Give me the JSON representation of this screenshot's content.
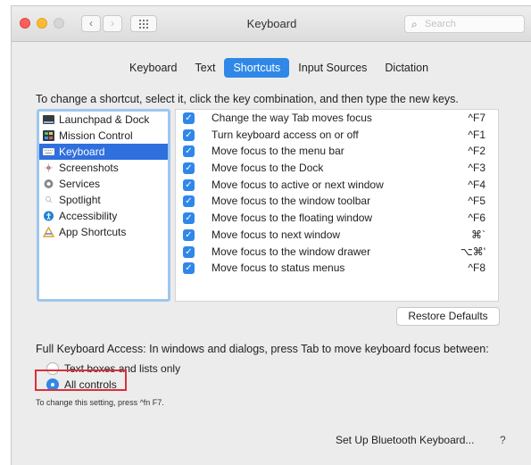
{
  "window": {
    "title": "Keyboard"
  },
  "search": {
    "placeholder": "Search"
  },
  "toolbar": {
    "back_icon": "‹",
    "forward_icon": "›"
  },
  "tabs": [
    {
      "label": "Keyboard",
      "selected": false
    },
    {
      "label": "Text",
      "selected": false
    },
    {
      "label": "Shortcuts",
      "selected": true
    },
    {
      "label": "Input Sources",
      "selected": false
    },
    {
      "label": "Dictation",
      "selected": false
    }
  ],
  "instruction": "To change a shortcut, select it, click the key combination, and then type the new keys.",
  "categories": [
    {
      "label": "Launchpad & Dock",
      "icon": "dock-icon",
      "selected": false
    },
    {
      "label": "Mission Control",
      "icon": "mission-control-icon",
      "selected": false
    },
    {
      "label": "Keyboard",
      "icon": "keyboard-icon",
      "selected": true
    },
    {
      "label": "Screenshots",
      "icon": "screenshot-icon",
      "selected": false
    },
    {
      "label": "Services",
      "icon": "gear-icon",
      "selected": false
    },
    {
      "label": "Spotlight",
      "icon": "spotlight-icon",
      "selected": false
    },
    {
      "label": "Accessibility",
      "icon": "accessibility-icon",
      "selected": false
    },
    {
      "label": "App Shortcuts",
      "icon": "app-shortcuts-icon",
      "selected": false
    }
  ],
  "shortcuts": [
    {
      "checked": true,
      "label": "Change the way Tab moves focus",
      "key": "^F7"
    },
    {
      "checked": true,
      "label": "Turn keyboard access on or off",
      "key": "^F1"
    },
    {
      "checked": true,
      "label": "Move focus to the menu bar",
      "key": "^F2"
    },
    {
      "checked": true,
      "label": "Move focus to the Dock",
      "key": "^F3"
    },
    {
      "checked": true,
      "label": "Move focus to active or next window",
      "key": "^F4"
    },
    {
      "checked": true,
      "label": "Move focus to the window toolbar",
      "key": "^F5"
    },
    {
      "checked": true,
      "label": "Move focus to the floating window",
      "key": "^F6"
    },
    {
      "checked": true,
      "label": "Move focus to next window",
      "key": "⌘`"
    },
    {
      "checked": true,
      "label": "Move focus to the window drawer",
      "key": "⌥⌘'"
    },
    {
      "checked": true,
      "label": "Move focus to status menus",
      "key": "^F8"
    }
  ],
  "restore_button": "Restore Defaults",
  "full_keyboard_access": {
    "label": "Full Keyboard Access: In windows and dialogs, press Tab to move keyboard focus between:",
    "options": [
      {
        "label": "Text boxes and lists only",
        "selected": false
      },
      {
        "label": "All controls",
        "selected": true
      }
    ],
    "hint": "To change this setting, press ^fn F7."
  },
  "bluetooth_button": "Set Up Bluetooth Keyboard...",
  "help_button": "?",
  "colors": {
    "accent": "#2f88e8",
    "selection": "#2f6fde",
    "highlight_box": "#d9303b"
  }
}
